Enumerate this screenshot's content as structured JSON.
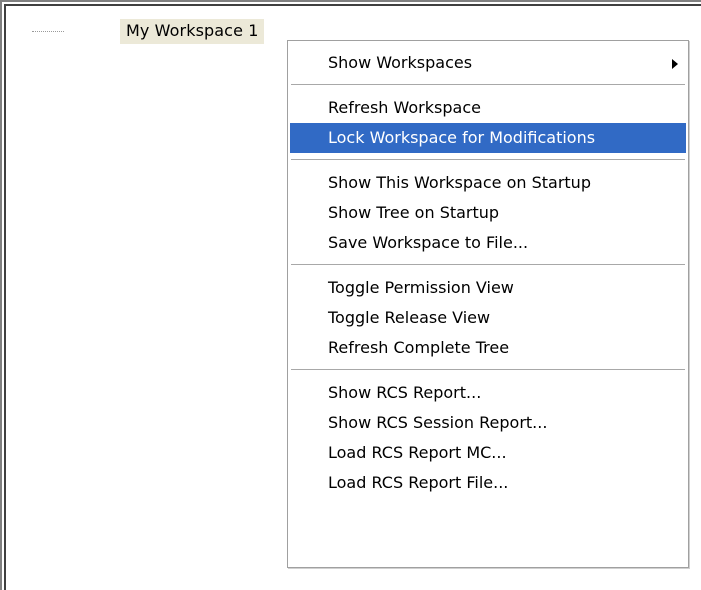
{
  "tree": {
    "node_label": "My Workspace 1"
  },
  "context_menu": {
    "groups": [
      [
        {
          "label": "Show Workspaces",
          "has_submenu": true
        }
      ],
      [
        {
          "label": "Refresh Workspace"
        },
        {
          "label": "Lock Workspace for Modifications",
          "highlighted": true
        }
      ],
      [
        {
          "label": "Show This Workspace on Startup"
        },
        {
          "label": "Show Tree on Startup"
        },
        {
          "label": "Save Workspace to File..."
        }
      ],
      [
        {
          "label": "Toggle Permission View"
        },
        {
          "label": "Toggle Release View"
        },
        {
          "label": "Refresh Complete Tree"
        }
      ],
      [
        {
          "label": "Show RCS Report..."
        },
        {
          "label": "Show RCS Session Report..."
        },
        {
          "label": "Load RCS Report MC..."
        },
        {
          "label": "Load RCS Report File..."
        }
      ]
    ]
  },
  "colors": {
    "highlight": "#316ac5",
    "node_background": "#ece9d8"
  }
}
